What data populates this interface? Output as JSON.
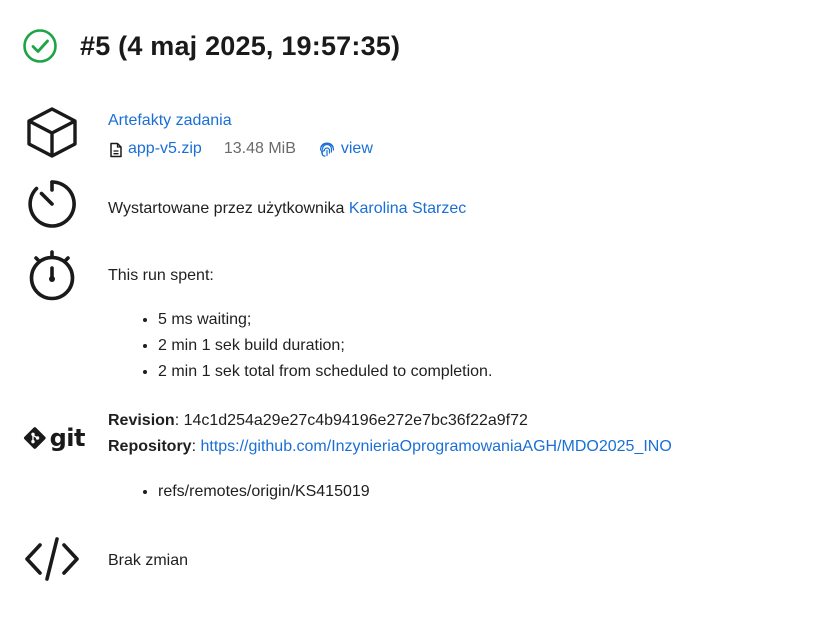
{
  "header": {
    "title": "#5 (4 maj 2025, 19:57:35)",
    "status_color": "#1ea446"
  },
  "artifacts": {
    "title": "Artefakty zadania",
    "file_name": "app-v5.zip",
    "file_size": "13.48 MiB",
    "view_label": "view"
  },
  "started_by": {
    "prefix": "Wystartowane przez użytkownika ",
    "user": "Karolina Starzec"
  },
  "run_spent": {
    "heading": "This run spent:",
    "items": [
      "5 ms waiting;",
      "2 min 1 sek build duration;",
      "2 min 1 sek total from scheduled to completion."
    ]
  },
  "git": {
    "logo_text": "git",
    "revision_label": "Revision",
    "revision_value": ": 14c1d254a29e27c4b94196e272e7bc36f22a9f72",
    "repository_label": "Repository",
    "repository_sep": ": ",
    "repository_url": "https://github.com/InzynieriaOprogramowaniaAGH/MDO2025_INO",
    "refs": [
      "refs/remotes/origin/KS415019"
    ]
  },
  "changes": {
    "text": "Brak zmian"
  },
  "colors": {
    "link": "#1a6fd6",
    "muted": "#6b6b6b",
    "success": "#1ea446"
  }
}
